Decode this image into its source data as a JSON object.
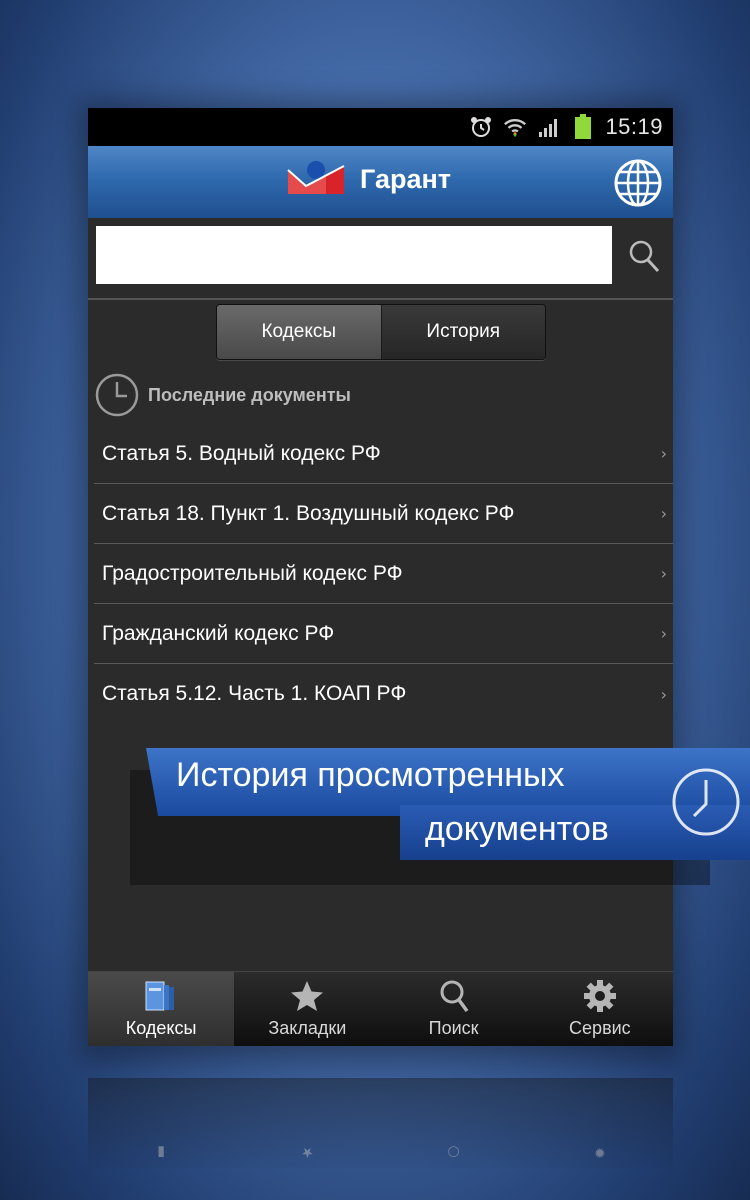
{
  "status_bar": {
    "time": "15:19",
    "icons": [
      "alarm-icon",
      "wifi-icon",
      "signal-icon",
      "battery-icon"
    ]
  },
  "header": {
    "title": "Гарант",
    "logo_icon": "garant-logo",
    "right_icon": "globe-icon"
  },
  "search": {
    "value": "",
    "placeholder": "",
    "icon": "search-icon"
  },
  "segments": {
    "codes": "Кодексы",
    "history": "История",
    "active": "codes"
  },
  "recent": {
    "title": "Последние документы",
    "icon": "clock-icon",
    "items": [
      "Статья 5. Водный кодекс РФ",
      "Статья 18. Пункт 1. Воздушный кодекс РФ",
      "Градостроительный кодекс РФ",
      "Гражданский кодекс РФ",
      "Статья 5.12. Часть 1. КОАП РФ"
    ]
  },
  "tabbar": {
    "active": "codes",
    "tabs": [
      {
        "label": "Кодексы",
        "icon": "books-icon"
      },
      {
        "label": "Закладки",
        "icon": "star-icon"
      },
      {
        "label": "Поиск",
        "icon": "search-icon"
      },
      {
        "label": "Сервис",
        "icon": "gear-icon"
      }
    ]
  },
  "banner": {
    "line1": "История просмотренных",
    "line2": "документов",
    "icon": "clock-icon"
  },
  "colors": {
    "header_blue": "#2f6aae",
    "banner_blue": "#2a5cb4",
    "background": "#2b2b2b"
  }
}
